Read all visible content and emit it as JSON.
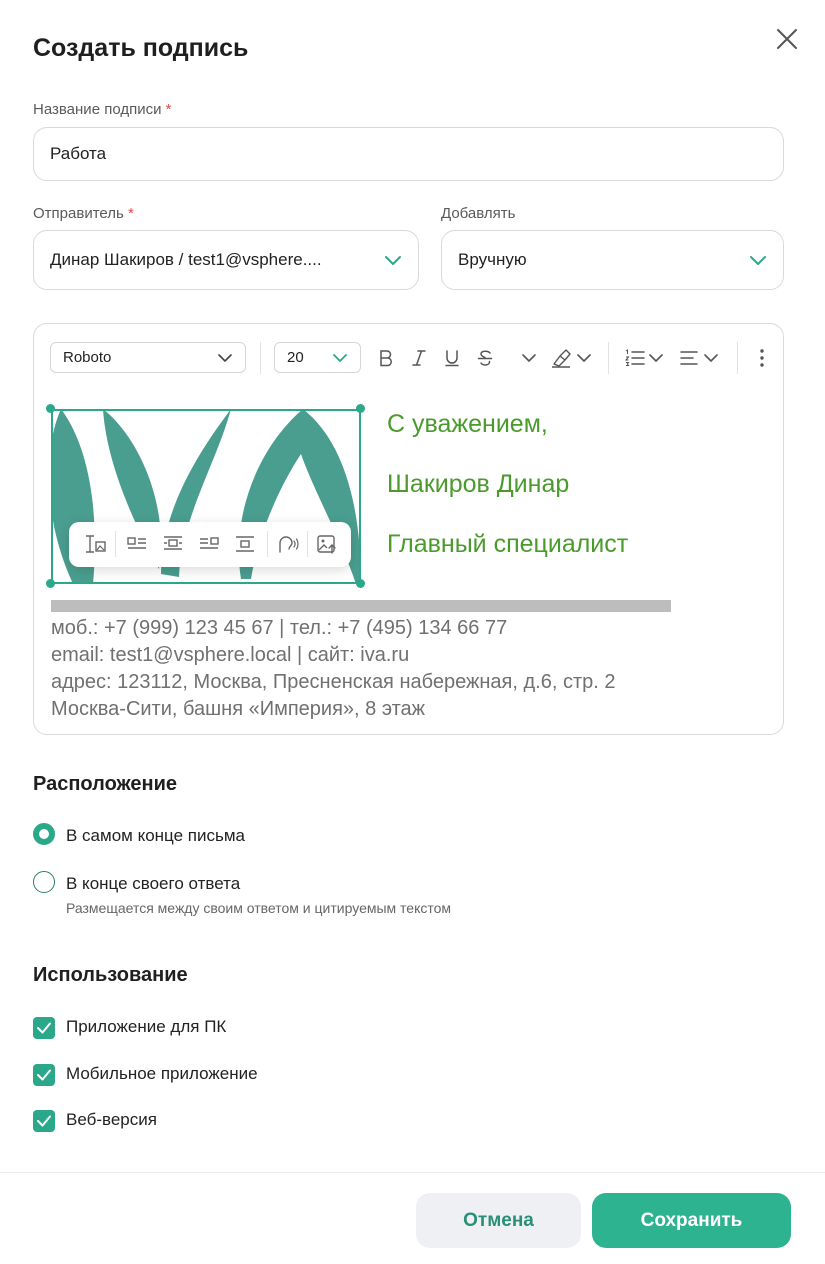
{
  "dialog": {
    "title": "Создать подпись"
  },
  "signature_name": {
    "label": "Название подписи",
    "required_mark": "*",
    "value": "Работа"
  },
  "sender": {
    "label": "Отправитель",
    "required_mark": "*",
    "value": "Динар Шакиров / test1@vsphere...."
  },
  "add_mode": {
    "label": "Добавлять",
    "value": "Вручную"
  },
  "editor": {
    "font_family": "Roboto",
    "font_size": "20",
    "signature_lines": [
      "С уважением,",
      "Шакиров Динар",
      "Главный специалист"
    ],
    "contact_lines": [
      "моб.: +7 (999) 123 45 67 | тел.: +7 (495) 134 66 77",
      "email: test1@vsphere.local | сайт: iva.ru",
      "адрес: 123112, Москва, Пресненская набережная, д.6, стр. 2",
      "Москва-Сити, башня «Империя», 8 этаж"
    ]
  },
  "placement": {
    "title": "Расположение",
    "options": [
      {
        "label": "В самом конце письма",
        "selected": true
      },
      {
        "label": "В конце своего ответа",
        "hint": "Размещается между своим ответом и цитируемым текстом",
        "selected": false
      }
    ]
  },
  "usage": {
    "title": "Использование",
    "options": [
      {
        "label": "Приложение для ПК",
        "checked": true
      },
      {
        "label": "Мобильное приложение",
        "checked": true
      },
      {
        "label": "Веб-версия",
        "checked": true
      }
    ]
  },
  "footer": {
    "cancel_label": "Отмена",
    "save_label": "Сохранить"
  },
  "colors": {
    "accent": "#2db38f",
    "signature_text": "#4a9a2c",
    "logo_leaf": "#4a9e8f",
    "required": "#e5484d"
  }
}
